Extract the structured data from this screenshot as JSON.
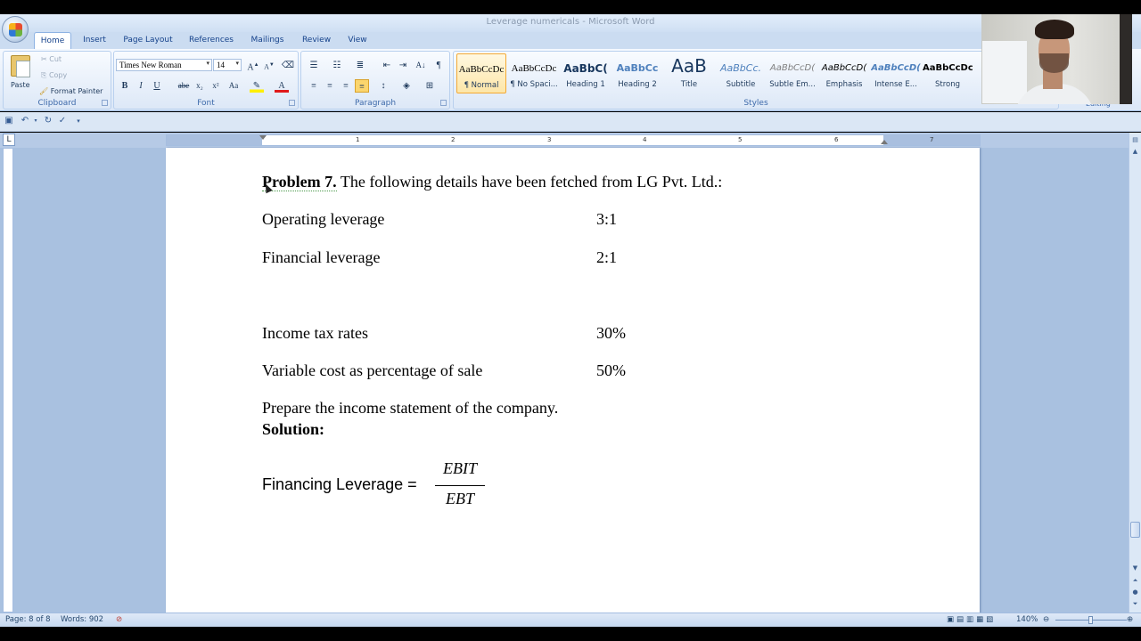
{
  "window": {
    "title": "Leverage numericals - Microsoft Word"
  },
  "tabs": [
    "Home",
    "Insert",
    "Page Layout",
    "References",
    "Mailings",
    "Review",
    "View"
  ],
  "clipboard": {
    "paste": "Paste",
    "cut": "Cut",
    "copy": "Copy",
    "format_painter": "Format Painter",
    "group": "Clipboard"
  },
  "font": {
    "name": "Times New Roman",
    "size": "14",
    "group": "Font"
  },
  "paragraph": {
    "group": "Paragraph"
  },
  "styles": {
    "group": "Styles",
    "items": [
      {
        "preview": "AaBbCcDc",
        "name": "¶ Normal"
      },
      {
        "preview": "AaBbCcDc",
        "name": "¶ No Spaci..."
      },
      {
        "preview": "AaBbC(",
        "name": "Heading 1"
      },
      {
        "preview": "AaBbCc",
        "name": "Heading 2"
      },
      {
        "preview": "AaB",
        "name": "Title"
      },
      {
        "preview": "AaBbCc.",
        "name": "Subtitle"
      },
      {
        "preview": "AaBbCcD(",
        "name": "Subtle Em..."
      },
      {
        "preview": "AaBbCcD(",
        "name": "Emphasis"
      },
      {
        "preview": "AaBbCcD(",
        "name": "Intense E..."
      },
      {
        "preview": "AaBbCcDc",
        "name": "Strong"
      }
    ]
  },
  "editing": {
    "group": "Editing"
  },
  "ruler": {
    "numbers": [
      "1",
      "2",
      "3",
      "4",
      "5",
      "6",
      "7"
    ]
  },
  "document": {
    "problem_label": "Problem 7.",
    "problem_text": " The following details have been fetched from LG Pvt. Ltd.:",
    "rows": [
      {
        "label": "Operating leverage",
        "value": "3:1"
      },
      {
        "label": "Financial leverage",
        "value": "2:1"
      },
      {
        "label": "Income tax rates",
        "value": "30%"
      },
      {
        "label": "Variable cost as percentage of sale",
        "value": "50%"
      }
    ],
    "prepare": "Prepare the income statement of the company.",
    "solution": "Solution:",
    "formula": {
      "lhs": "Financing Leverage =",
      "numerator": "EBIT",
      "denominator": "EBT"
    }
  },
  "status": {
    "page": "Page: 8 of 8",
    "words": "Words: 902",
    "zoom": "140%"
  },
  "colors": {
    "ribbon": "#dbe7f7",
    "workspace": "#a9c1e0",
    "accent": "#15428b"
  }
}
